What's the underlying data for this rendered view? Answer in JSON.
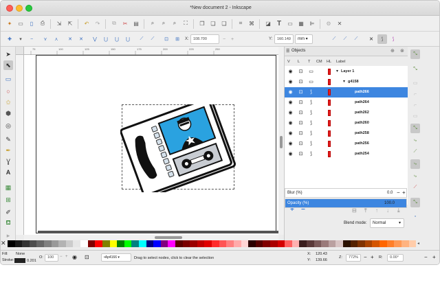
{
  "window": {
    "title": "*New document 2 - Inkscape"
  },
  "toolbar2": {
    "x_label": "X:",
    "x_value": "108.700",
    "y_label": "Y:",
    "y_value": "160.140",
    "unit": "mm"
  },
  "ruler_h": [
    "75",
    "100",
    "125",
    "150",
    "175",
    "200",
    "225",
    "250"
  ],
  "objects_panel": {
    "tab_label": "Objects",
    "columns": [
      "V",
      "L",
      "T",
      "CM",
      "HL",
      "Label"
    ],
    "rows": [
      {
        "label": "Layer 1",
        "indent": 0,
        "expanded": true,
        "selected": false
      },
      {
        "label": "g4158",
        "indent": 1,
        "expanded": true,
        "selected": false
      },
      {
        "label": "path266",
        "indent": 2,
        "expanded": false,
        "selected": true
      },
      {
        "label": "path264",
        "indent": 2,
        "expanded": false,
        "selected": false
      },
      {
        "label": "path262",
        "indent": 2,
        "expanded": false,
        "selected": false
      },
      {
        "label": "path260",
        "indent": 2,
        "expanded": false,
        "selected": false
      },
      {
        "label": "path258",
        "indent": 2,
        "expanded": false,
        "selected": false
      },
      {
        "label": "path256",
        "indent": 2,
        "expanded": false,
        "selected": false
      },
      {
        "label": "path254",
        "indent": 2,
        "expanded": false,
        "selected": false
      }
    ],
    "add_label": "+",
    "remove_label": "−",
    "blend_label": "Blend mode:",
    "blend_value": "Normal",
    "blur_label": "Blur (%)",
    "blur_value": "0.0",
    "opacity_label": "Opacity (%)",
    "opacity_value": "100.0"
  },
  "status": {
    "fill_label": "Fill:",
    "fill_value": "None",
    "stroke_label": "Stroke:",
    "stroke_width": "0.201",
    "opacity_label": "O:",
    "opacity_value": "100",
    "layer_value": "•Ap4166",
    "message": "Drag to select nodes, click to clear the selection",
    "x_label": "X:",
    "x_value": "120.43",
    "y_label": "Y:",
    "y_value": "139.66",
    "z_label": "Z:",
    "zoom_value": "772%",
    "r_label": "R:",
    "rotation_value": "0.00°"
  },
  "colors": {
    "accent": "#3d86e0",
    "highlight": "#e62222",
    "phone_blue": "#2aa2e0"
  }
}
